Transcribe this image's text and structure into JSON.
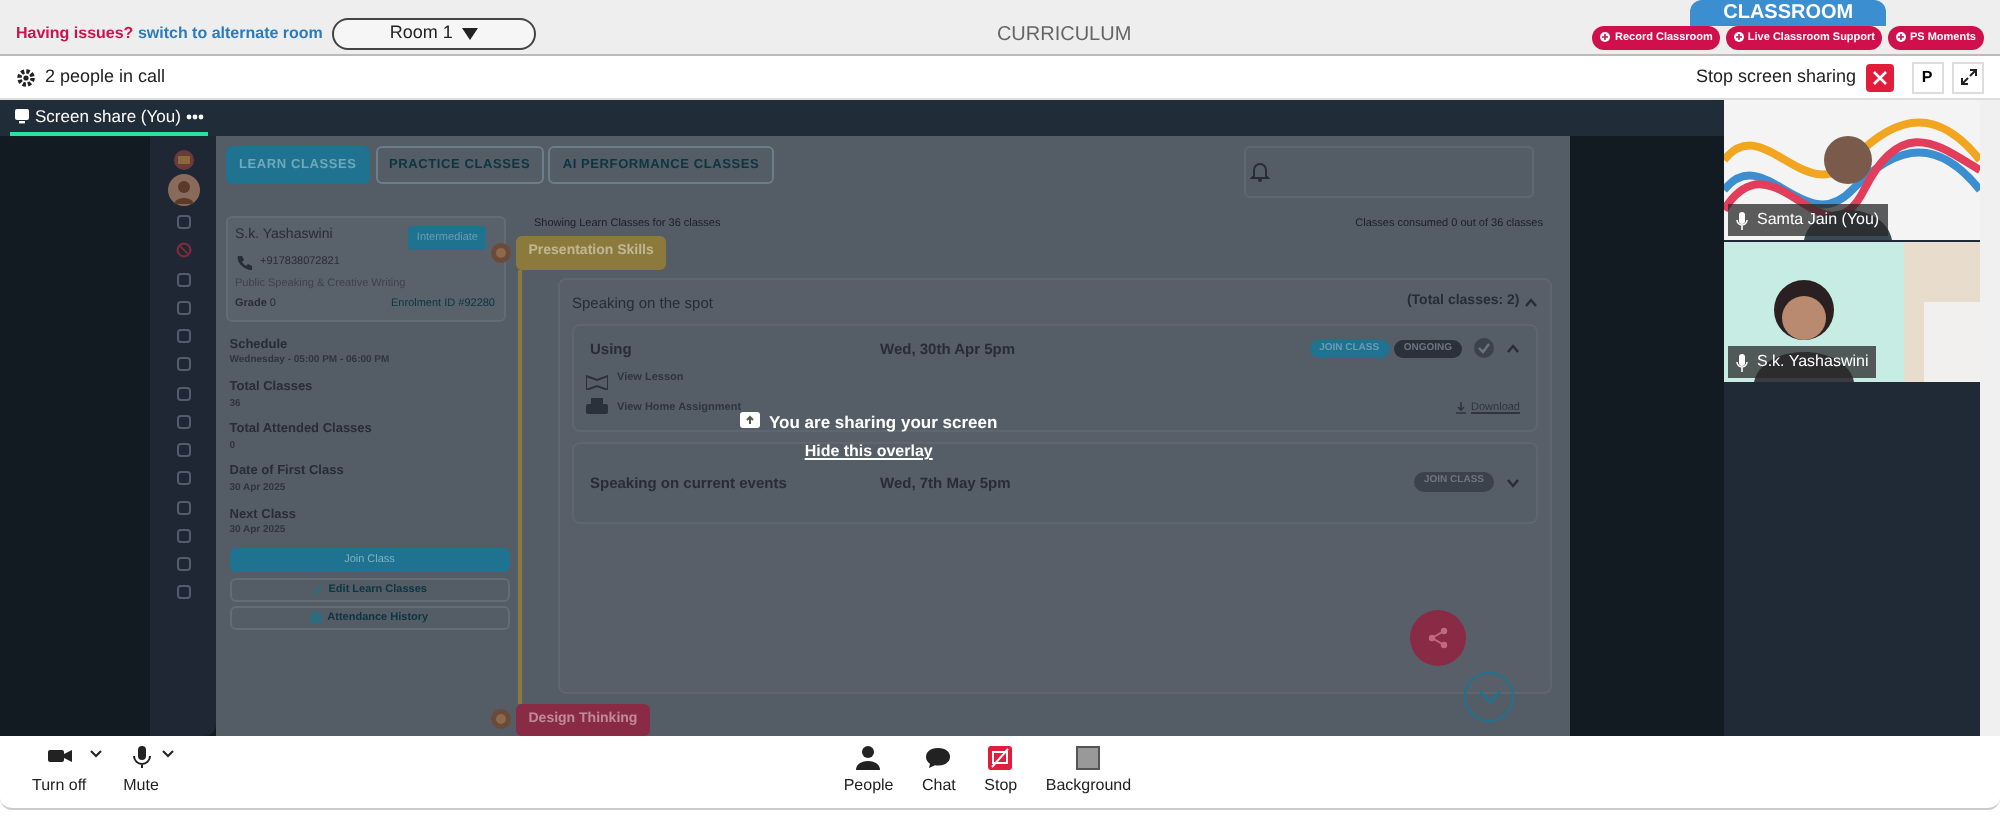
{
  "top_bar": {
    "issue_text": "Having issues?",
    "alternate_link": "switch to alternate room",
    "room_select": {
      "value": "Room 1"
    },
    "title": "CURRICULUM",
    "tab": "CLASSROOM",
    "actions": [
      {
        "label": "Record Classroom"
      },
      {
        "label": "Live Classroom Support"
      },
      {
        "label": "PS Moments"
      }
    ]
  },
  "call_bar": {
    "people_text": "2 people in call",
    "stop_sharing": "Stop screen sharing",
    "avatar_button": "P"
  },
  "share_tab": {
    "label": "Screen share (You)"
  },
  "shared_screen": {
    "tabs": [
      {
        "label": "LEARN CLASSES",
        "selected": true
      },
      {
        "label": "PRACTICE CLASSES",
        "selected": false
      },
      {
        "label": "AI PERFORMANCE CLASSES",
        "selected": false
      }
    ],
    "student": {
      "name": "S.k. Yashaswini",
      "level": "Intermediate",
      "phone": "+917838072821",
      "course": "Public Speaking & Creative Writing",
      "grade_label": "Grade",
      "grade": "0",
      "enrolment": "Enrolment ID #92280"
    },
    "details": [
      {
        "label": "Schedule",
        "value": "Wednesday - 05:00 PM - 06:00 PM"
      },
      {
        "label": "Total Classes",
        "value": "36"
      },
      {
        "label": "Total Attended Classes",
        "value": "0"
      },
      {
        "label": "Date of First Class",
        "value": "30 Apr 2025"
      },
      {
        "label": "Next Class",
        "value": "30 Apr 2025"
      }
    ],
    "buttons": [
      {
        "label": "Join Class",
        "kind": "primary"
      },
      {
        "label": "Edit Learn Classes",
        "kind": "edit"
      },
      {
        "label": "Attendance History",
        "kind": "history"
      }
    ],
    "showing_text": "Showing Learn Classes for 36 classes",
    "consumed_text": "Classes consumed 0 out of 36 classes",
    "modules": [
      {
        "title": "Presentation Skills",
        "color": "#8c7a3c"
      },
      {
        "title": "Design Thinking",
        "color": "#8a2b45"
      }
    ],
    "section": {
      "title": "Speaking on the spot",
      "total": "(Total classes: 2)",
      "lessons": [
        {
          "title": "Using",
          "date": "Wed, 30th Apr 5pm",
          "badges": [
            {
              "label": "JOIN CLASS",
              "kind": "join"
            },
            {
              "label": "ONGOING",
              "kind": "status"
            }
          ],
          "done": true,
          "expanded": true,
          "links": [
            {
              "label": "View Lesson",
              "kind": "lesson"
            },
            {
              "label": "View Home Assignment",
              "kind": "assignment"
            }
          ],
          "download": "Download"
        },
        {
          "title": "Speaking on current events",
          "date": "Wed, 7th May 5pm",
          "badges": [
            {
              "label": "JOIN CLASS",
              "kind": "muted"
            }
          ],
          "done": false,
          "expanded": false
        }
      ]
    }
  },
  "overlay": {
    "message": "You are sharing your screen",
    "hide_link": "Hide this overlay"
  },
  "participants": [
    {
      "name": "Samta Jain (You)",
      "kind": "picture"
    },
    {
      "name": "S.k. Yashaswini",
      "kind": "picture"
    }
  ],
  "toolbar": {
    "left": [
      {
        "label": "Turn off",
        "kind": "camera"
      },
      {
        "label": "Mute",
        "kind": "mic"
      }
    ],
    "center": [
      {
        "label": "People",
        "kind": "people"
      },
      {
        "label": "Chat",
        "kind": "chat"
      },
      {
        "label": "Stop",
        "kind": "stop"
      },
      {
        "label": "Background",
        "kind": "background"
      }
    ]
  }
}
